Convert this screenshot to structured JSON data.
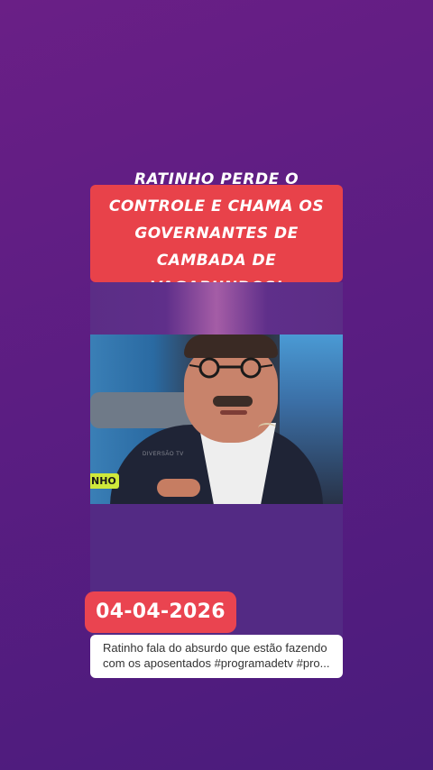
{
  "story": {
    "headline": "RATINHO PERDE O CONTROLE E CHAMA OS GOVERNANTES DE CAMBADA DE VAGABUNDOS!",
    "video": {
      "watermark": "DIVERSÃO TV",
      "logo_tag": "NHO"
    },
    "date": "04-04-2026",
    "caption_line1": "Ratinho fala do absurdo que estão fazendo",
    "caption_line2": "com os aposentados #programadetv #pro..."
  },
  "colors": {
    "background": "#5b1d82",
    "headline_bg": "#e8424a",
    "date_bg": "#ea4450",
    "caption_bg": "#ffffff"
  }
}
